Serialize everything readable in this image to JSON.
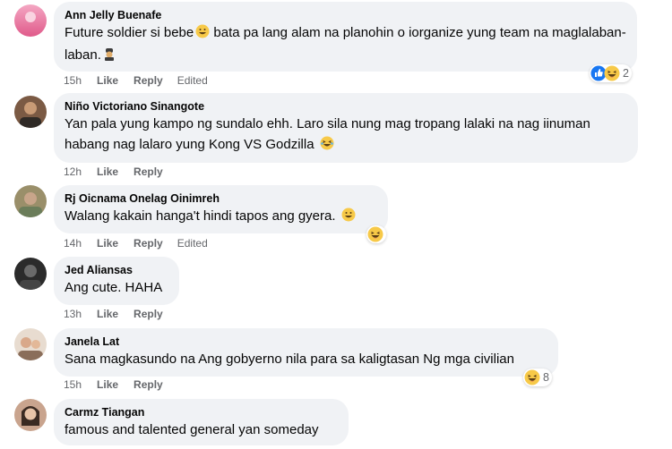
{
  "actions": {
    "like": "Like",
    "reply": "Reply",
    "edited": "Edited"
  },
  "colors": {
    "bubble": "#f0f2f5",
    "meta": "#65676b",
    "like_blue": "#1877f2",
    "haha_yellow": "#f7c948"
  },
  "comments": [
    {
      "author": "Ann Jelly Buenafe",
      "text": "Future soldier si bebe",
      "text_emoji": "grinning-face-icon",
      "text_cont": " bata pa lang alam na planohin o iorganize yung team na maglalaban-laban.",
      "text_end_emoji": "soldier-icon",
      "time": "15h",
      "edited": true,
      "reactions": [
        "like-reaction-icon",
        "haha-reaction-icon"
      ],
      "reaction_count": "2"
    },
    {
      "author": "Niño Victoriano Sinangote",
      "text": "Yan pala yung kampo ng sundalo ehh. Laro sila nung mag tropang lalaki na nag iinuman habang nag lalaro yung Kong VS Godzilla",
      "text_end_emoji": "laughing-tears-icon",
      "time": "12h",
      "edited": false
    },
    {
      "author": "Rj Oicnama Onelag Oinimreh",
      "text": "Walang kakain hanga't hindi tapos ang gyera.",
      "text_end_emoji": "grinning-face-icon",
      "time": "14h",
      "edited": true,
      "reactions": [
        "haha-reaction-icon"
      ],
      "reaction_count": ""
    },
    {
      "author": "Jed Aliansas",
      "text": "Ang cute. HAHA",
      "time": "13h",
      "edited": false
    },
    {
      "author": "Janela Lat",
      "text": "Sana magkasundo na Ang gobyerno nila para sa kaligtasan Ng mga civilian",
      "time": "15h",
      "edited": false,
      "reactions": [
        "haha-reaction-icon"
      ],
      "reaction_count": "8"
    },
    {
      "author": "Carmz Tiangan",
      "text": "famous and talented general yan someday"
    }
  ]
}
